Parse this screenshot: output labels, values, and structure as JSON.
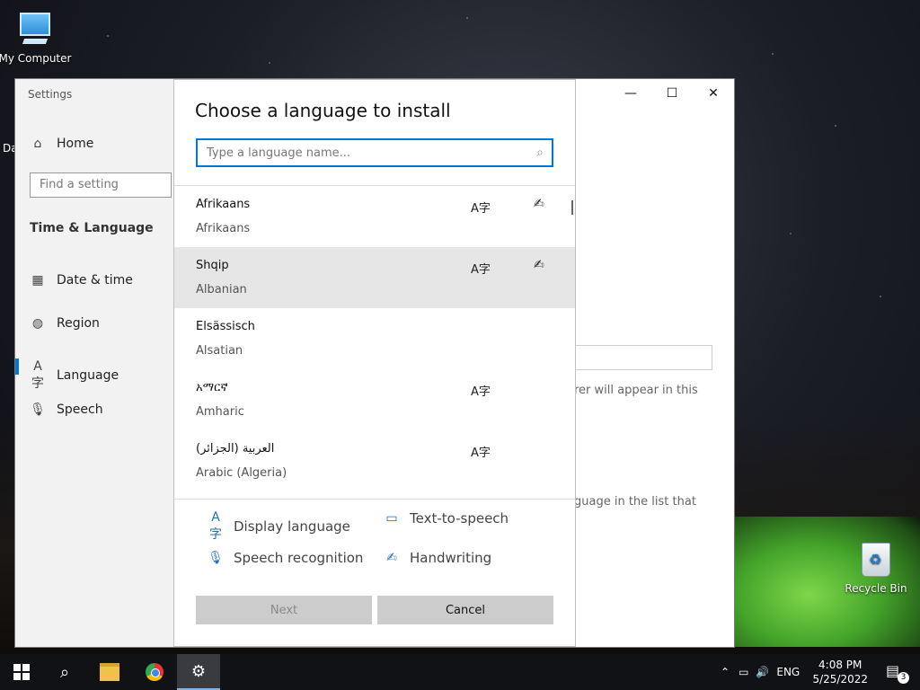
{
  "desktop": {
    "icons": [
      {
        "label": "My Computer",
        "icon": "computer-icon"
      },
      {
        "label": "Recycle Bin",
        "icon": "recycle-bin-icon"
      }
    ],
    "partial_label": "Da"
  },
  "settings": {
    "title": "Settings",
    "home": "Home",
    "search_placeholder": "Find a setting",
    "section": "Time & Language",
    "nav": [
      {
        "label": "Date & time",
        "icon": "calendar-clock-icon"
      },
      {
        "label": "Region",
        "icon": "globe-icon"
      },
      {
        "label": "Language",
        "icon": "language-icon",
        "selected": true
      },
      {
        "label": "Speech",
        "icon": "microphone-icon"
      }
    ],
    "window_buttons": {
      "minimize": "—",
      "maximize": "☐",
      "close": "✕"
    },
    "background_text": {
      "line1": "rer will appear in this",
      "line2": "guage in the list that"
    }
  },
  "dialog": {
    "title": "Choose a language to install",
    "search_placeholder": "Type a language name...",
    "languages": [
      {
        "native": "Afrikaans",
        "english": "Afrikaans",
        "display": true,
        "handwriting": true
      },
      {
        "native": "Shqip",
        "english": "Albanian",
        "display": true,
        "handwriting": true,
        "selected": true
      },
      {
        "native": "Elsässisch",
        "english": "Alsatian",
        "display": false,
        "handwriting": false
      },
      {
        "native": "አማርኛ",
        "english": "Amharic",
        "display": true,
        "handwriting": false
      },
      {
        "native": "العربية (الجزائر)",
        "english": "Arabic (Algeria)",
        "display": true,
        "handwriting": false
      }
    ],
    "legend": {
      "display_language": "Display language",
      "text_to_speech": "Text-to-speech",
      "speech_recognition": "Speech recognition",
      "handwriting": "Handwriting"
    },
    "buttons": {
      "next": "Next",
      "cancel": "Cancel"
    }
  },
  "taskbar": {
    "input_language": "ENG",
    "time": "4:08 PM",
    "date": "5/25/2022",
    "notification_count": "3"
  },
  "colors": {
    "accent": "#0078d4",
    "taskbar": "#111216"
  }
}
